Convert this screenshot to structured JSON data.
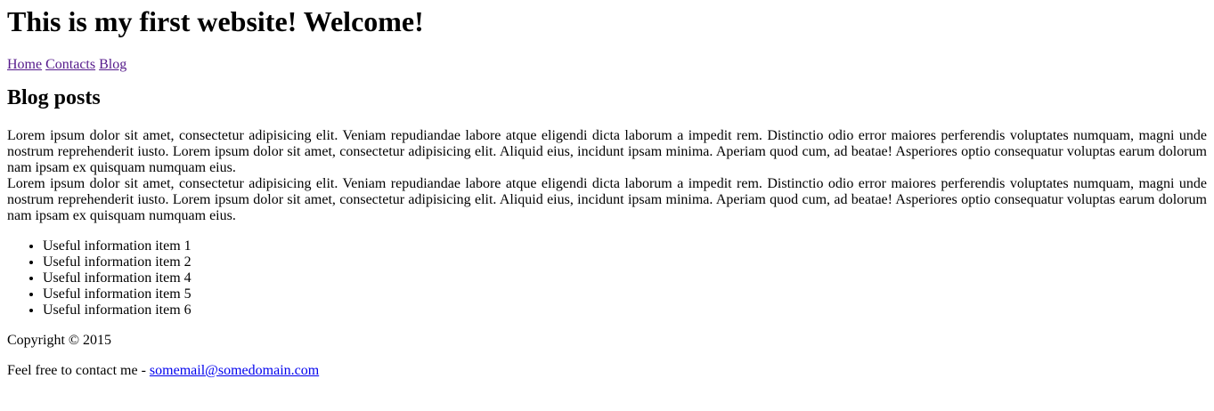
{
  "header": {
    "title": "This is my first website! Welcome!"
  },
  "nav": {
    "items": [
      {
        "label": "Home",
        "color": "#551a8b"
      },
      {
        "label": "Contacts",
        "color": "#551a8b"
      },
      {
        "label": "Blog",
        "color": "#551a8b"
      }
    ]
  },
  "main": {
    "section_title": "Blog posts",
    "posts": [
      "Lorem ipsum dolor sit amet, consectetur adipisicing elit. Veniam repudiandae labore atque eligendi dicta laborum a impedit rem. Distinctio odio error maiores perferendis voluptates numquam, magni unde nostrum reprehenderit iusto. Lorem ipsum dolor sit amet, consectetur adipisicing elit. Aliquid eius, incidunt ipsam minima. Aperiam quod cum, ad beatae! Asperiores optio consequatur voluptas earum dolorum nam ipsam ex quisquam numquam eius.",
      "Lorem ipsum dolor sit amet, consectetur adipisicing elit. Veniam repudiandae labore atque eligendi dicta laborum a impedit rem. Distinctio odio error maiores perferendis voluptates numquam, magni unde nostrum reprehenderit iusto. Lorem ipsum dolor sit amet, consectetur adipisicing elit. Aliquid eius, incidunt ipsam minima. Aperiam quod cum, ad beatae! Asperiores optio consequatur voluptas earum dolorum nam ipsam ex quisquam numquam eius."
    ],
    "list_items": [
      "Useful information item 1",
      "Useful information item 2",
      "Useful information item 4",
      "Useful information item 5",
      "Useful information item 6"
    ]
  },
  "footer": {
    "copyright": "Copyright © 2015",
    "contact_prefix": "Feel free to contact me - ",
    "contact_email": "somemail@somedomain.com",
    "link_color": "#0000ee"
  }
}
